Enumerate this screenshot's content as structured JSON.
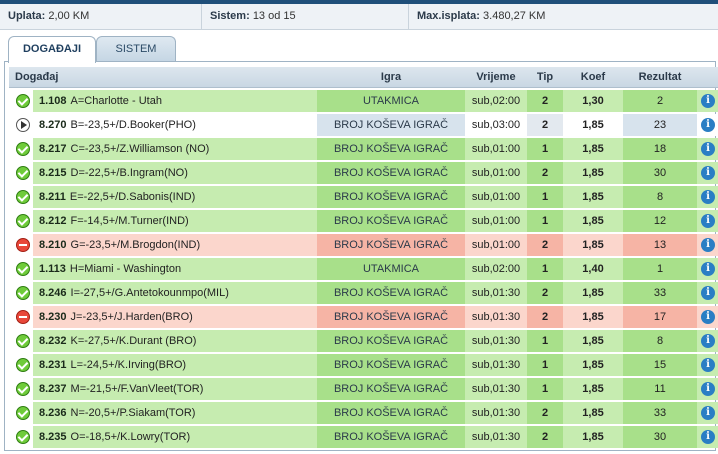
{
  "summary": {
    "uplata_label": "Uplata:",
    "uplata_value": "2,00 KM",
    "sistem_label": "Sistem:",
    "sistem_value": "13 od 15",
    "maxisplata_label": "Max.isplata:",
    "maxisplata_value": "3.480,27 KM"
  },
  "tabs": [
    {
      "label": "DOGAĐAJI",
      "active": true
    },
    {
      "label": "SISTEM",
      "active": false
    }
  ],
  "columns": {
    "event": "Događaj",
    "igra": "Igra",
    "vrijeme": "Vrijeme",
    "tip": "Tip",
    "koef": "Koef",
    "rezultat": "Rezultat"
  },
  "icons": {
    "status_won": "check-circle-icon",
    "status_lost": "minus-circle-icon",
    "status_pending": "play-circle-icon",
    "info": "info-icon"
  },
  "info_glyph": "i",
  "rows": [
    {
      "status": "won",
      "code": "1.108",
      "event": "A=Charlotte - Utah",
      "igra": "UTAKMICA",
      "time": "sub,02:00",
      "tip": "2",
      "koef": "1,30",
      "result": "2"
    },
    {
      "status": "pending",
      "code": "8.270",
      "event": "B=-23,5+/D.Booker(PHO)",
      "igra": "BROJ KOŠEVA IGRAČ",
      "time": "sub,03:00",
      "tip": "2",
      "koef": "1,85",
      "result": "23"
    },
    {
      "status": "won",
      "code": "8.217",
      "event": "C=-23,5+/Z.Williamson (NO)",
      "igra": "BROJ KOŠEVA IGRAČ",
      "time": "sub,01:00",
      "tip": "1",
      "koef": "1,85",
      "result": "18"
    },
    {
      "status": "won",
      "code": "8.215",
      "event": "D=-22,5+/B.Ingram(NO)",
      "igra": "BROJ KOŠEVA IGRAČ",
      "time": "sub,01:00",
      "tip": "2",
      "koef": "1,85",
      "result": "30"
    },
    {
      "status": "won",
      "code": "8.211",
      "event": "E=-22,5+/D.Sabonis(IND)",
      "igra": "BROJ KOŠEVA IGRAČ",
      "time": "sub,01:00",
      "tip": "1",
      "koef": "1,85",
      "result": "8"
    },
    {
      "status": "won",
      "code": "8.212",
      "event": "F=-14,5+/M.Turner(IND)",
      "igra": "BROJ KOŠEVA IGRAČ",
      "time": "sub,01:00",
      "tip": "1",
      "koef": "1,85",
      "result": "12"
    },
    {
      "status": "lost",
      "code": "8.210",
      "event": "G=-23,5+/M.Brogdon(IND)",
      "igra": "BROJ KOŠEVA IGRAČ",
      "time": "sub,01:00",
      "tip": "2",
      "koef": "1,85",
      "result": "13"
    },
    {
      "status": "won",
      "code": "1.113",
      "event": "H=Miami - Washington",
      "igra": "UTAKMICA",
      "time": "sub,02:00",
      "tip": "1",
      "koef": "1,40",
      "result": "1"
    },
    {
      "status": "won",
      "code": "8.246",
      "event": "I=-27,5+/G.Antetokounmpo(MIL)",
      "igra": "BROJ KOŠEVA IGRAČ",
      "time": "sub,01:30",
      "tip": "2",
      "koef": "1,85",
      "result": "33"
    },
    {
      "status": "lost",
      "code": "8.230",
      "event": "J=-23,5+/J.Harden(BRO)",
      "igra": "BROJ KOŠEVA IGRAČ",
      "time": "sub,01:30",
      "tip": "2",
      "koef": "1,85",
      "result": "17"
    },
    {
      "status": "won",
      "code": "8.232",
      "event": "K=-27,5+/K.Durant (BRO)",
      "igra": "BROJ KOŠEVA IGRAČ",
      "time": "sub,01:30",
      "tip": "1",
      "koef": "1,85",
      "result": "8"
    },
    {
      "status": "won",
      "code": "8.231",
      "event": "L=-24,5+/K.Irving(BRO)",
      "igra": "BROJ KOŠEVA IGRAČ",
      "time": "sub,01:30",
      "tip": "1",
      "koef": "1,85",
      "result": "15"
    },
    {
      "status": "won",
      "code": "8.237",
      "event": "M=-21,5+/F.VanVleet(TOR)",
      "igra": "BROJ KOŠEVA IGRAČ",
      "time": "sub,01:30",
      "tip": "1",
      "koef": "1,85",
      "result": "11"
    },
    {
      "status": "won",
      "code": "8.236",
      "event": "N=-20,5+/P.Siakam(TOR)",
      "igra": "BROJ KOŠEVA IGRAČ",
      "time": "sub,01:30",
      "tip": "2",
      "koef": "1,85",
      "result": "33"
    },
    {
      "status": "won",
      "code": "8.235",
      "event": "O=-18,5+/K.Lowry(TOR)",
      "igra": "BROJ KOŠEVA IGRAČ",
      "time": "sub,01:30",
      "tip": "2",
      "koef": "1,85",
      "result": "30"
    }
  ]
}
